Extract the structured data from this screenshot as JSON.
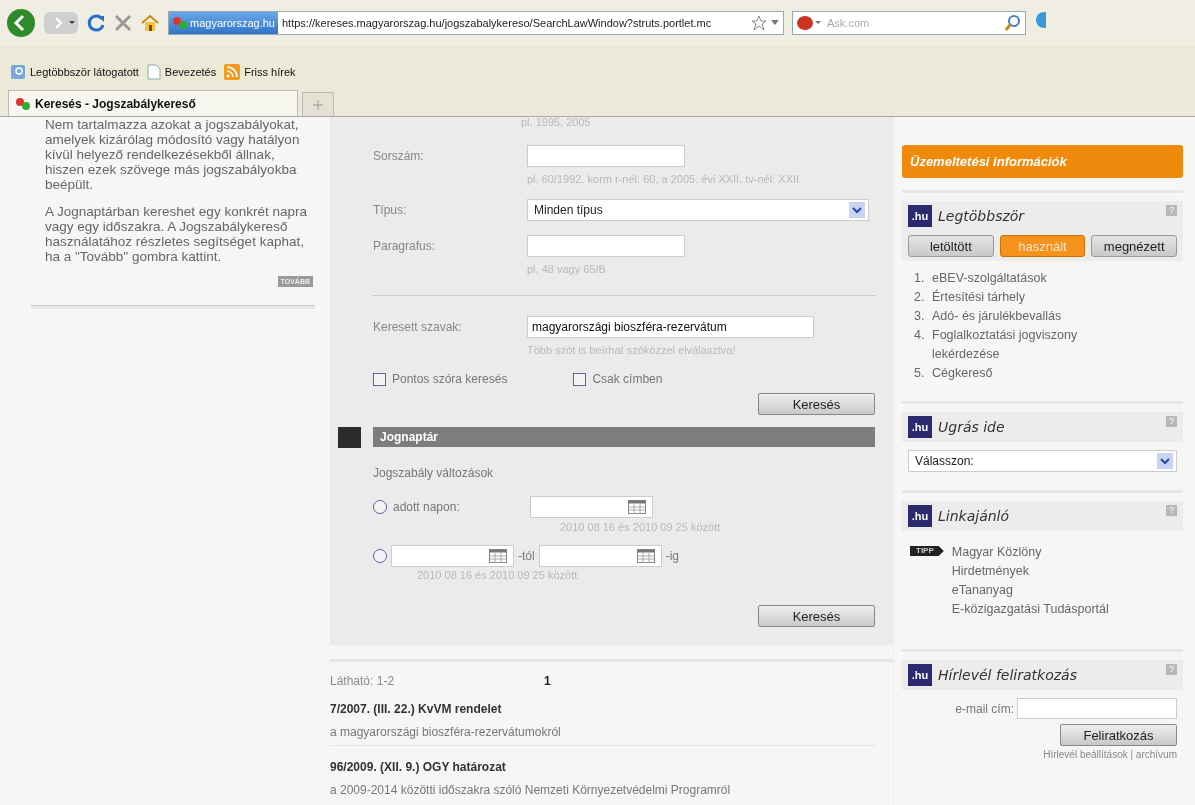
{
  "browser": {
    "site_label": "magyarorszag.hu",
    "url": "https://kereses.magyarorszag.hu/jogszabalykereso/SearchLawWindow?struts.portlet.mc",
    "search_placeholder": "Ask.com",
    "bookmarks": [
      {
        "label": "Legtöbbször látogatott",
        "kind": "search"
      },
      {
        "label": "Bevezetés",
        "kind": "page"
      },
      {
        "label": "Friss hírek",
        "kind": "feed"
      }
    ],
    "tabs": [
      {
        "label": "Keresés - Jogszabálykereső",
        "selected": true
      }
    ]
  },
  "intro": {
    "paragraphs": [
      "Nem tartalmazza azokat a jogszabályokat, amelyek kizárólag módosító vagy hatályon kívül helyező rendelkezésekből állnak, hiszen ezek szövege más jogszabályokba beépült.",
      "A Jognaptárban kereshet egy konkrét napra vagy egy időszakra. A Jogszabálykereső használatához részletes segítséget kaphat, ha a \"Tovább\" gombra kattint."
    ],
    "more_button": "TOVÁBB"
  },
  "search_form": {
    "top_hint": "pl. 1995, 2005",
    "fields": [
      {
        "kind": "text",
        "label": "Sorszám:",
        "hint": "pl. 60/1992. korm r-nél: 60, a 2005. évi XXII. tv-nél: XXII"
      },
      {
        "kind": "select",
        "label": "Típus:",
        "value": "Minden típus"
      },
      {
        "kind": "text",
        "label": "Paragrafus:",
        "hint": "pl. 48 vagy 65/B"
      }
    ],
    "keywords": {
      "label": "Keresett szavak:",
      "value": "magyarországi bioszféra-rezervátum",
      "hint": "Több szót is beírhat szóközzel elválasztva!"
    },
    "checkboxes": [
      {
        "label": "Pontos szóra keresés",
        "checked": false
      },
      {
        "label": "Csak címben",
        "checked": false
      }
    ],
    "button": "Keresés"
  },
  "calendar": {
    "title": "Jognaptár",
    "subtitle": "Jogszabály változások",
    "single": {
      "label": "adott napon:",
      "selected": false,
      "hint": "2010 08 16 és 2010 09 25 között"
    },
    "range": {
      "from_suffix": "-tól",
      "to_suffix": "-ig",
      "selected": false,
      "hint": "2010 08 16 és 2010 09 25 között"
    },
    "button": "Keresés"
  },
  "results": {
    "visible": "Látható: 1-2",
    "page": "1",
    "items": [
      {
        "title": "7/2007. (III. 22.) KvVM rendelet",
        "description": "a magyarországi bioszféra-rezervátumokról"
      },
      {
        "title": "96/2009. (XII. 9.) OGY határozat",
        "description": "a 2009-2014 közötti időszakra szóló Nemzeti Környezetvédelmi Programról"
      }
    ]
  },
  "sidebar": {
    "notice": "Üzemeltetési információk",
    "most": {
      "logo": ".hu",
      "help": "?",
      "title": "Legtöbbször",
      "tabs": [
        {
          "label": "letöltött",
          "selected": false
        },
        {
          "label": "használt",
          "selected": true
        },
        {
          "label": "megnézett",
          "selected": false
        }
      ],
      "items": [
        {
          "number": "1.",
          "label": "eBEV-szolgáltatások"
        },
        {
          "number": "2.",
          "label": "Értesítési tárhely"
        },
        {
          "number": "3.",
          "label": "Adó- és járulékbevallás"
        },
        {
          "number": "4.",
          "label": "Foglalkoztatási jogviszony lekérdezése"
        },
        {
          "number": "5.",
          "label": "Cégkereső"
        }
      ]
    },
    "jump": {
      "logo": ".hu",
      "help": "?",
      "title": "Ugrás ide",
      "select": "Válasszon:"
    },
    "links": {
      "logo": ".hu",
      "help": "?",
      "title": "Linkajánló",
      "badge": "TIPP",
      "items": [
        "Magyar Közlöny",
        "Hirdetmények",
        "eTananyag",
        "E-közigazgatási Tudásportál"
      ]
    },
    "newsletter": {
      "logo": ".hu",
      "help": "?",
      "title": "Hírlevél feliratkozás",
      "email_label": "e-mail cím:",
      "button": "Feliratkozás",
      "footer": "Hírlevél beállítások | archívum"
    }
  }
}
